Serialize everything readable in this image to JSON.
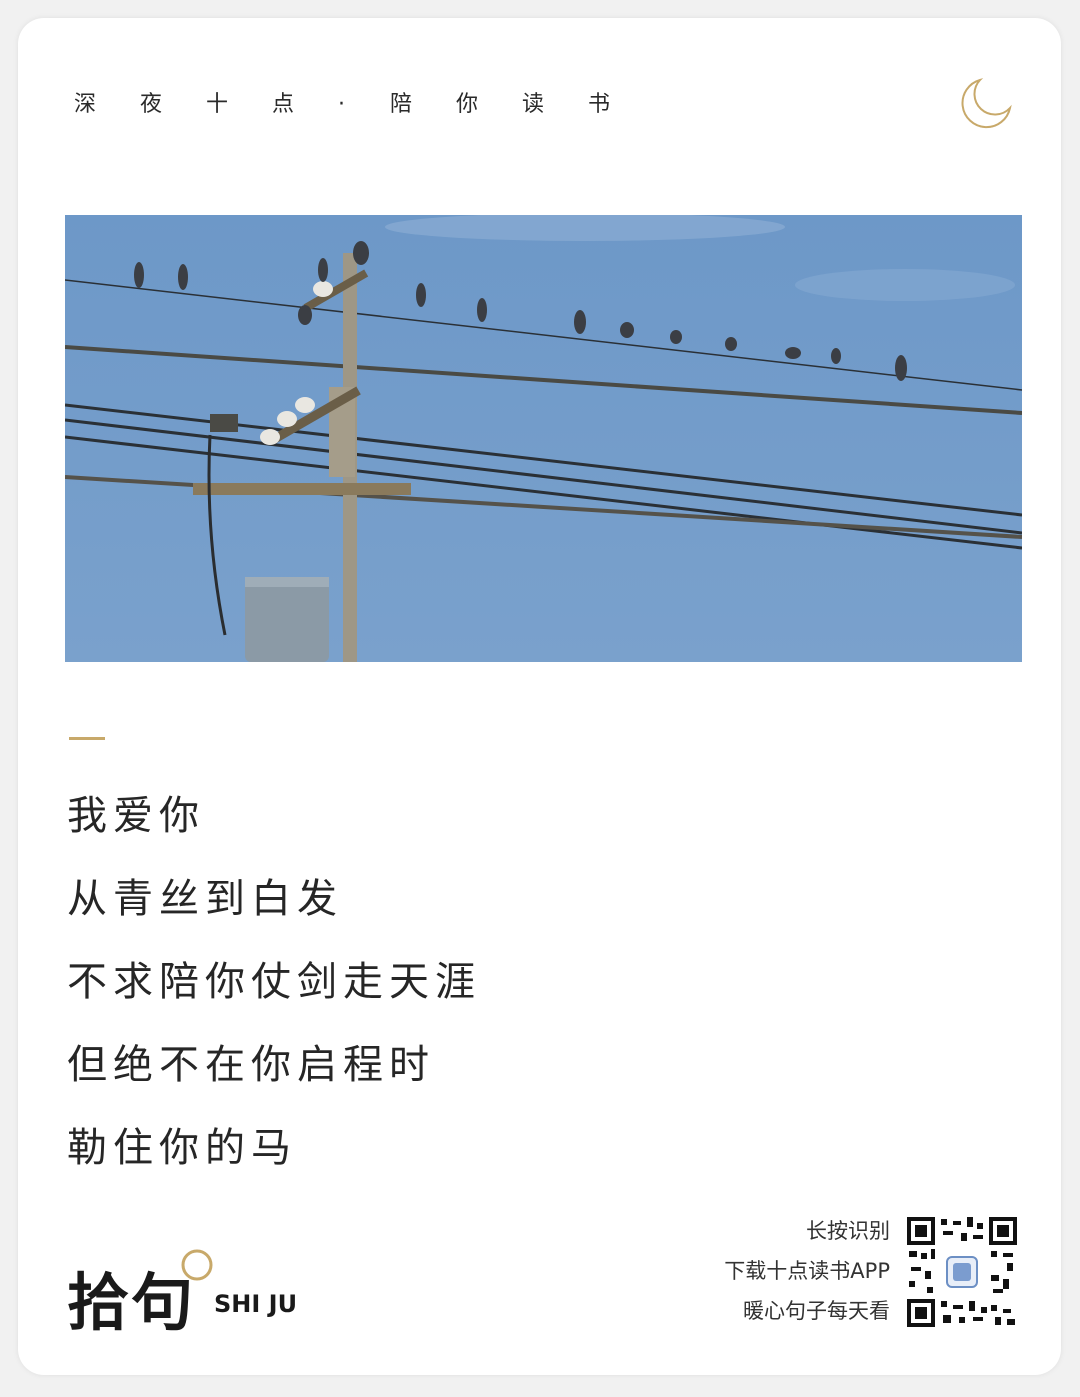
{
  "header": {
    "chars": [
      "深",
      "夜",
      "十",
      "点",
      "·",
      "陪",
      "你",
      "读",
      "书"
    ]
  },
  "icons": {
    "moon": "crescent-moon-icon",
    "qr": "qr-code-icon",
    "accent_color": "#c8a96a",
    "sky_color": "#6f9ac8"
  },
  "poem": {
    "lines": [
      "我爱你",
      "从青丝到白发",
      "不求陪你仗剑走天涯",
      "但绝不在你启程时",
      "勒住你的马"
    ]
  },
  "brand": {
    "name_cn": "拾句",
    "name_en": "SHI JU"
  },
  "qr_block": {
    "lines": [
      "长按识别",
      "下载十点读书APP",
      "暖心句子每天看"
    ]
  }
}
